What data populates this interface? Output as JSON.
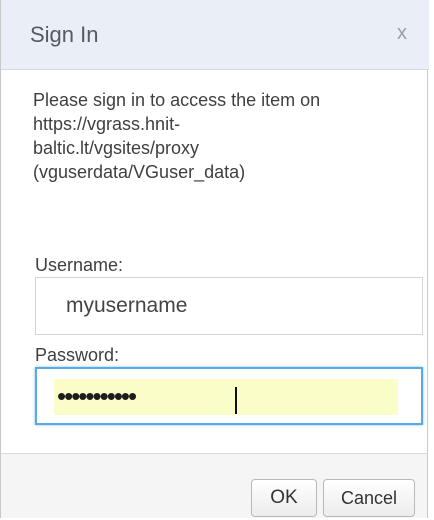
{
  "dialog": {
    "title": "Sign In",
    "close_glyph": "x",
    "message": "Please sign in to access the item on\nhttps://vgrass.hnit-\nbaltic.lt/vgsites/proxy\n(vguserdata/VGuser_data)"
  },
  "form": {
    "username_label": "Username:",
    "username_value": "myusername",
    "password_label": "Password:",
    "password_mask": "•••••••••••",
    "password_length": 11
  },
  "buttons": {
    "ok_label": "OK",
    "cancel_label": "Cancel"
  },
  "colors": {
    "titlebar_bg": "#eaeef6",
    "focus_border": "#5aa9e6",
    "autofill_bg": "#fbfdc8"
  },
  "icons": {
    "close": "close-icon"
  }
}
